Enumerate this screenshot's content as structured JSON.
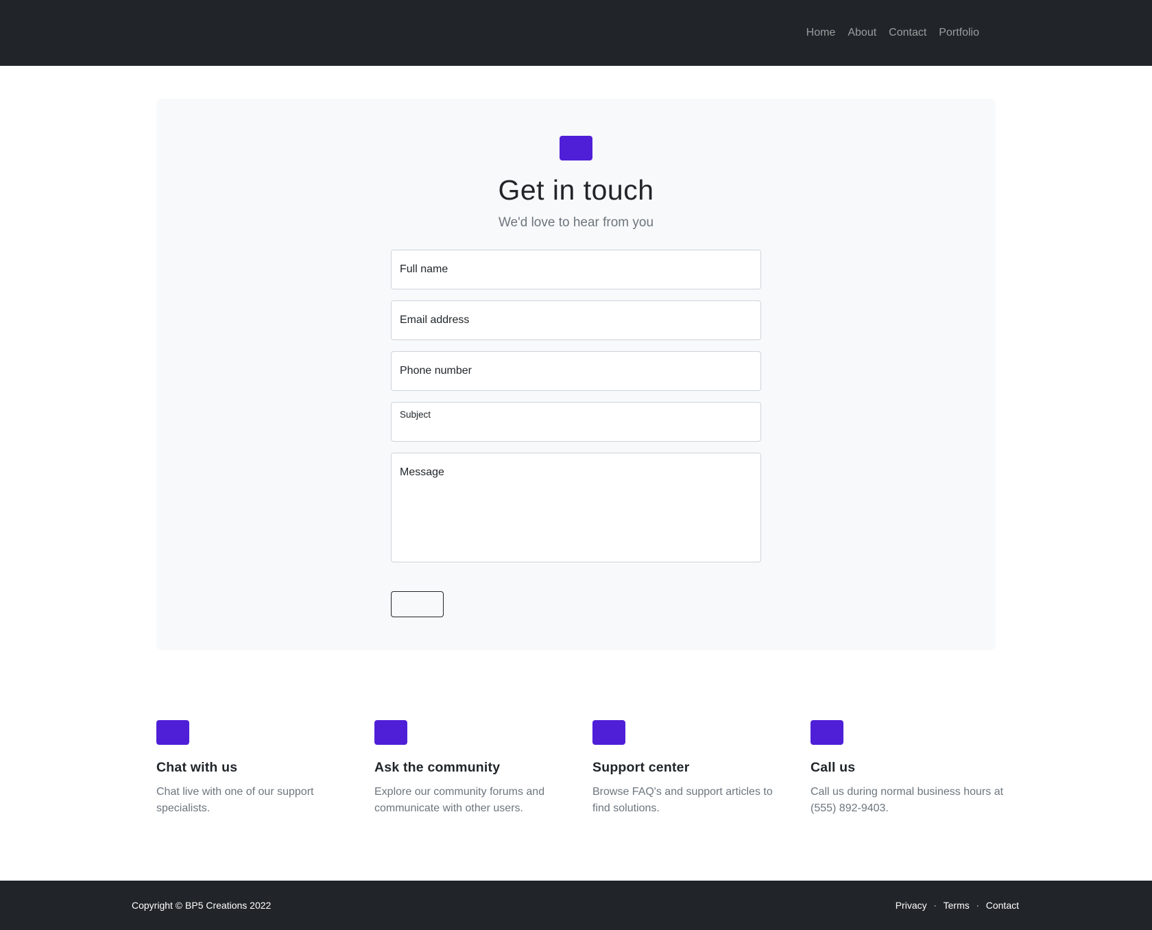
{
  "nav": {
    "links": [
      "Home",
      "About",
      "Contact",
      "Portfolio"
    ]
  },
  "contact": {
    "title": "Get in touch",
    "subtitle": "We'd love to hear from you",
    "fields": {
      "full_name": "Full name",
      "email": "Email address",
      "phone": "Phone number",
      "subject": "Subject",
      "message": "Message"
    },
    "submit_label": ""
  },
  "features": [
    {
      "icon": "chat-icon",
      "title": "Chat with us",
      "description": "Chat live with one of our support specialists."
    },
    {
      "icon": "people-icon",
      "title": "Ask the community",
      "description": "Explore our community forums and communicate with other users."
    },
    {
      "icon": "question-icon",
      "title": "Support center",
      "description": "Browse FAQ's and support articles to find solutions."
    },
    {
      "icon": "phone-icon",
      "title": "Call us",
      "description": "Call us during normal business hours at (555) 892-9403."
    }
  ],
  "footer": {
    "copyright": "Copyright © BP5 Creations 2022",
    "links": [
      "Privacy",
      "Terms",
      "Contact"
    ],
    "separator": "·"
  },
  "colors": {
    "accent": "#4f1fd8",
    "dark": "#212529",
    "card_bg": "#f8f9fa",
    "muted": "#6c757d"
  }
}
